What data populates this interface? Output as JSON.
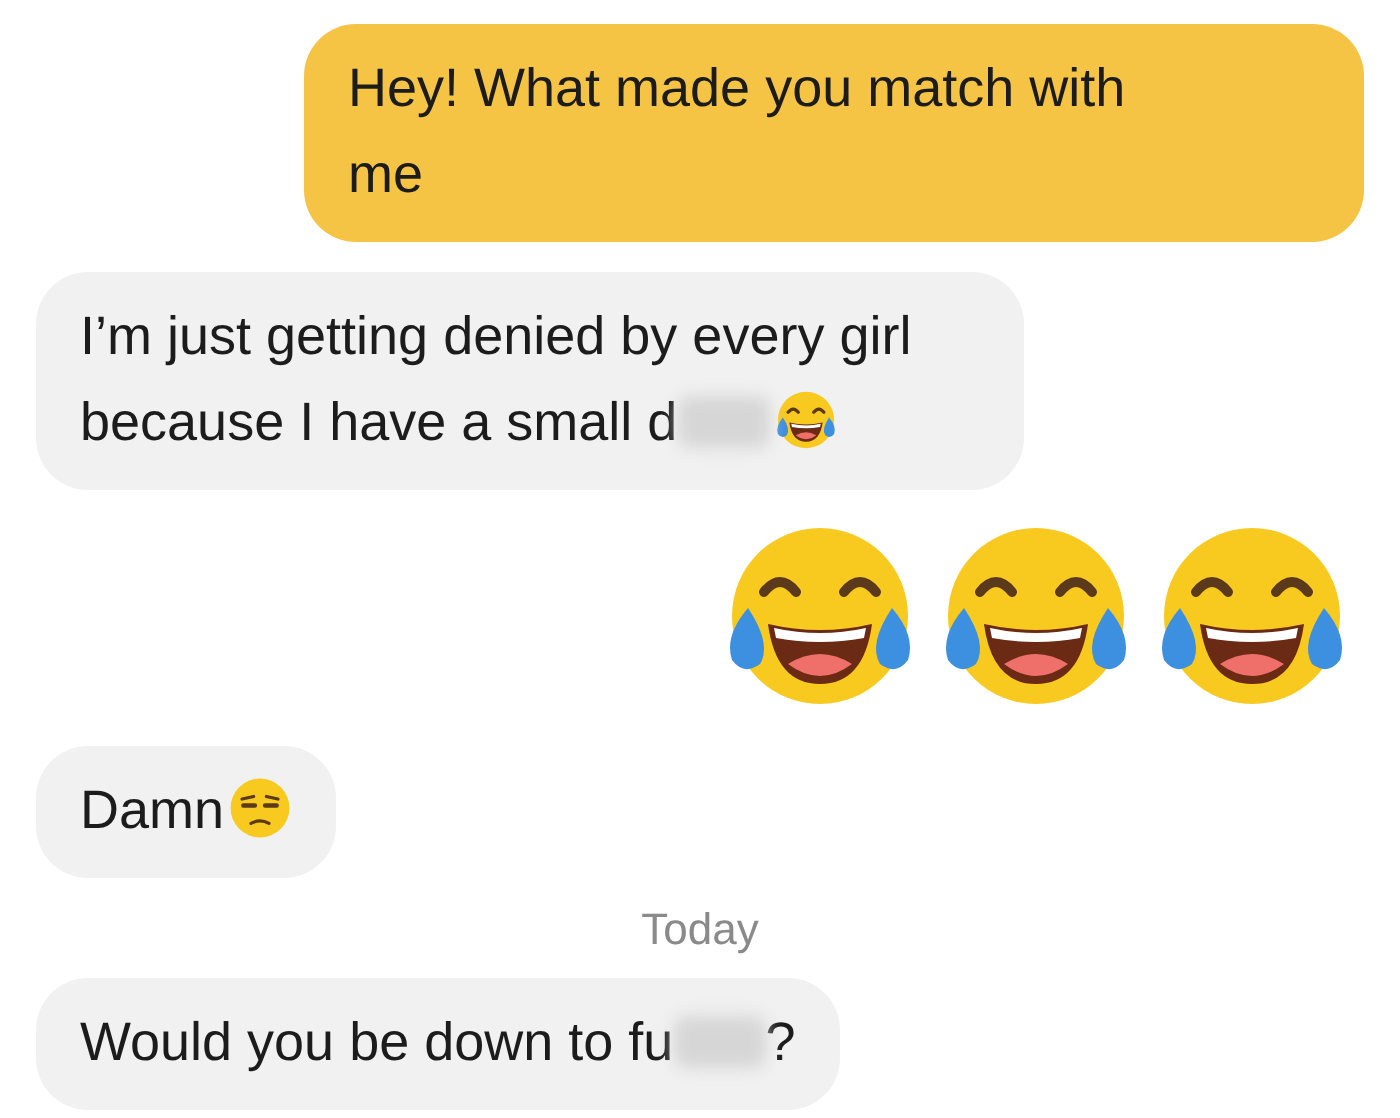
{
  "messages": [
    {
      "kind": "text",
      "outgoing": true,
      "text": "Hey! What made you match with me",
      "censored": false
    },
    {
      "kind": "text",
      "outgoing": false,
      "text": "I’m just getting denied by every girl because I have a small d",
      "censored": true,
      "emoji": {
        "kind": "laughing"
      }
    },
    {
      "kind": "emojis",
      "outgoing": true,
      "emojis": [
        {
          "kind": "laughing"
        },
        {
          "kind": "laughing"
        },
        {
          "kind": "laughing"
        }
      ]
    },
    {
      "kind": "text",
      "outgoing": false,
      "text": "Damn",
      "censored": false,
      "emoji": {
        "kind": "unamused"
      }
    },
    {
      "kind": "divider",
      "text": "Today"
    },
    {
      "kind": "text",
      "outgoing": false,
      "text": "Would you be down to fu",
      "censored": true,
      "after": "?"
    }
  ]
}
